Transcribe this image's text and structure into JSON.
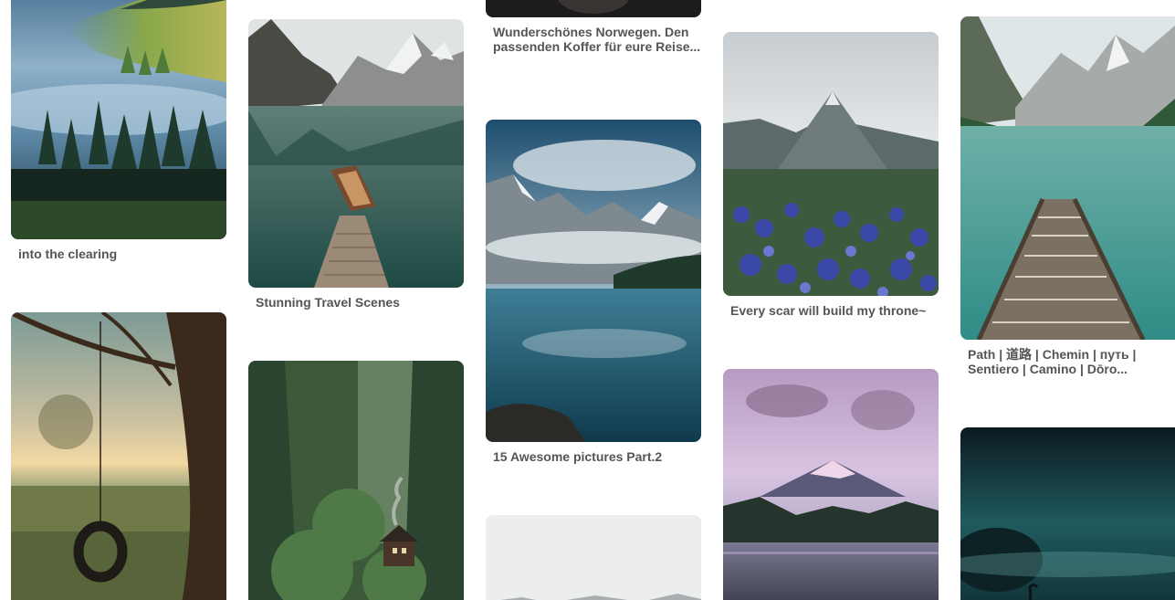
{
  "pins": {
    "fog_forest": {
      "title": "into the clearing",
      "image": "misty-forest-valley"
    },
    "swing": {
      "image": "tire-swing-meadow-sunset"
    },
    "boat_lake": {
      "title": "Stunning Travel Scenes",
      "image": "boat-on-mountain-lake"
    },
    "cabin": {
      "image": "forest-cabin"
    },
    "norway": {
      "title": "Wunderschönes Norwegen. Den passenden Koffer für eure Reise...",
      "image": "dark-photo"
    },
    "moraine": {
      "title": "15 Awesome pictures Part.2",
      "image": "glacier-lake-reflection"
    },
    "snow": {
      "image": "snowy-mountains"
    },
    "lupine": {
      "title": "Every scar will build my throne~",
      "image": "mountain-peak-lupine-flowers"
    },
    "hood": {
      "image": "mountain-pink-sky-lake"
    },
    "pier": {
      "title": "Path | 道路 | Chemin | путь | Sentiero | Camino | Dōro...",
      "image": "wooden-pier-alpine-lake"
    },
    "heron": {
      "image": "heron-misty-teal-water"
    }
  }
}
